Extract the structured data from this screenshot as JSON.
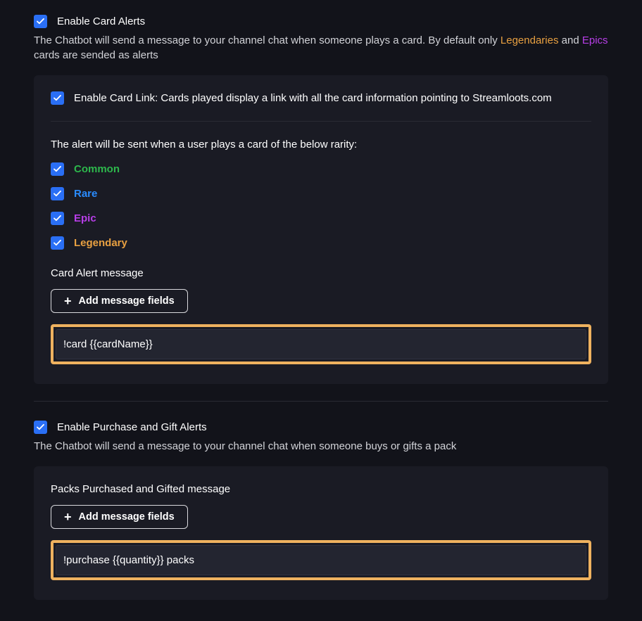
{
  "cardAlerts": {
    "enable_label": "Enable Card Alerts",
    "desc_pre": "The Chatbot will send a message to your channel chat when someone plays a card. By default only ",
    "legendaries_word": "Legendaries",
    "desc_mid": " and ",
    "epics_word": "Epics",
    "desc_post": " cards are sended as alerts",
    "link_label": "Enable Card Link: Cards played display a link with all the card information pointing to Streamloots.com",
    "rarity_intro": "The alert will be sent when a user plays a card of the below rarity:",
    "rarities": {
      "common": "Common",
      "rare": "Rare",
      "epic": "Epic",
      "legendary": "Legendary"
    },
    "message_label": "Card Alert message",
    "add_fields_label": "Add message fields",
    "message_value": "!card {{cardName}}"
  },
  "purchaseAlerts": {
    "enable_label": "Enable Purchase and Gift Alerts",
    "desc": "The Chatbot will send a message to your channel chat when someone buys or gifts a pack",
    "message_label": "Packs Purchased and Gifted message",
    "add_fields_label": "Add message fields",
    "message_value": "!purchase {{quantity}} packs"
  }
}
